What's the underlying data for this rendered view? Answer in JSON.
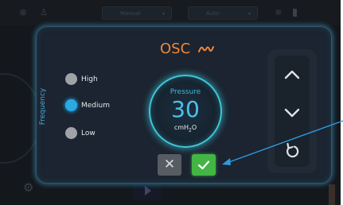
{
  "topbar": {
    "mode_manual": "Manual",
    "mode_auto": "Auto"
  },
  "modal": {
    "mode_title": "OSC",
    "frequency_label": "Frequency",
    "options": [
      {
        "label": "High",
        "selected": false
      },
      {
        "label": "Medium",
        "selected": true
      },
      {
        "label": "Low",
        "selected": false
      }
    ],
    "pressure": {
      "label": "Pressure",
      "value": "30",
      "unit_main": "cmH",
      "unit_sub": "2",
      "unit_end": "O"
    },
    "buttons": {
      "cancel_symbol": "✕"
    }
  },
  "colors": {
    "accent_orange": "#f0873a",
    "accent_blue": "#2ba9e3",
    "ring_cyan": "#3fc7d8",
    "confirm_green": "#43b544",
    "modal_bg": "#1b2430",
    "pointer_blue": "#2e9be0"
  },
  "icons": {
    "wave": "osc-wave-icon",
    "up": "chevron-up-icon",
    "down": "chevron-down-icon",
    "reset": "rotate-ccw-icon",
    "confirm": "check-icon",
    "cancel": "close-icon",
    "settings": "gear-icon",
    "play": "play-icon"
  }
}
